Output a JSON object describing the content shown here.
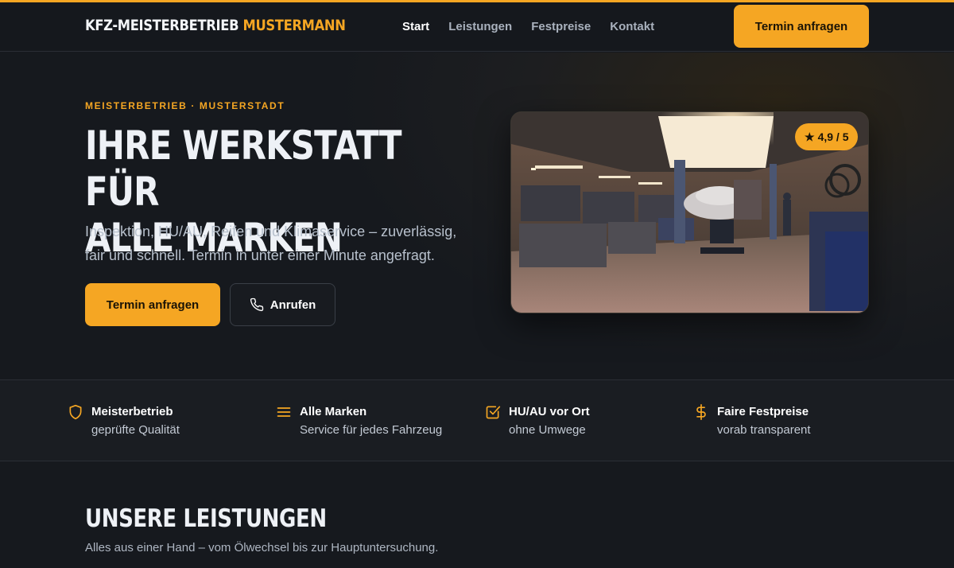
{
  "header": {
    "logo_main": "KFZ-MEISTERBETRIEB",
    "logo_accent": "MUSTERMANN",
    "nav": [
      "Start",
      "Leistungen",
      "Festpreise",
      "Kontakt"
    ],
    "active_nav": "Start",
    "cta_label": "Termin anfragen"
  },
  "hero": {
    "eyebrow": "MEISTERBETRIEB · MUSTERSTADT",
    "title": "IHRE WERKSTATT FÜR\nALLE MARKEN",
    "subtitle": "Inspektion, HU/AU, Reifen und Klimaservice – zuverlässig, fair und schnell. Termin in unter einer Minute angefragt.",
    "primary_button": "Termin anfragen",
    "secondary_button": "Anrufen",
    "rating": "4,9 / 5",
    "rating_icon": "star-icon"
  },
  "features": [
    {
      "icon": "shield-icon",
      "title": "Meisterbetrieb",
      "subtitle": "geprüfte Qualität"
    },
    {
      "icon": "menu-lines-icon",
      "title": "Alle Marken",
      "subtitle": "Service für jedes Fahrzeug"
    },
    {
      "icon": "checkbox-icon",
      "title": "HU/AU vor Ort",
      "subtitle": "ohne Umwege"
    },
    {
      "icon": "dollar-icon",
      "title": "Faire Festpreise",
      "subtitle": "vorab transparent"
    }
  ],
  "services": {
    "title": "UNSERE LEISTUNGEN",
    "subtitle": "Alles aus einer Hand – vom Ölwechsel bis zur Hauptuntersuchung."
  },
  "colors": {
    "accent": "#f5a623",
    "background": "#16191e",
    "text": "#eef1f6"
  }
}
